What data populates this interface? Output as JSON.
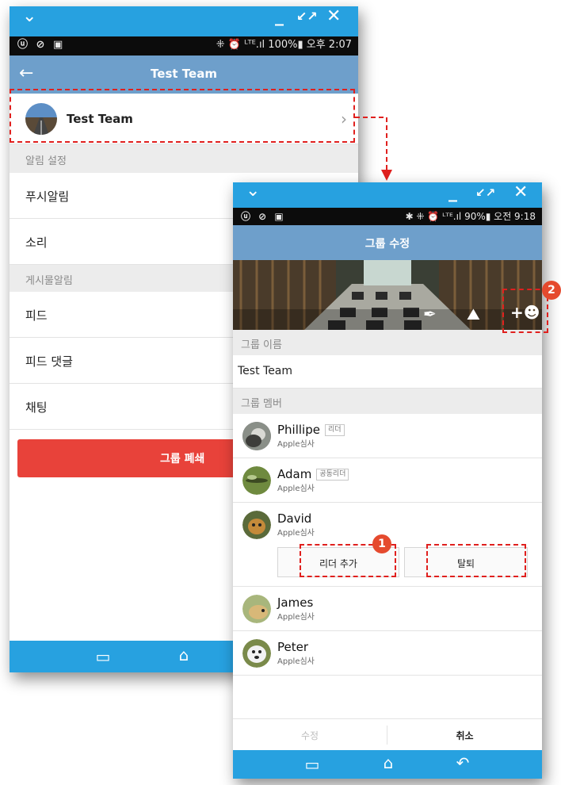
{
  "back_screen": {
    "status": {
      "left": "ⓤ ⊘ ▣",
      "right": "⁜ ⏰ ᴸᵀᴱ.ıl 100%▮ 오후 2:07"
    },
    "appbar_title": "Test Team",
    "team_name": "Test Team",
    "sections": {
      "notify": "알림 설정",
      "post_notify": "게시물알림"
    },
    "rows": {
      "push": "푸시알림",
      "sound": "소리",
      "feed": "피드",
      "feed_comment": "피드 댓글",
      "chat": "채팅"
    },
    "close_group_label": "그룹 폐쇄"
  },
  "front_screen": {
    "status": {
      "left": "ⓤ ⊘ ▣",
      "right": "✱ ⁜ ⏰ ᴸᵀᴱ.ıl 90%▮ 오전 9:18"
    },
    "appbar_title": "그룹 수정",
    "group_name_section": "그룹 이름",
    "group_name_value": "Test Team",
    "group_member_section": "그룹 멤버",
    "members": [
      {
        "name": "Phillipe",
        "tag": "리더",
        "sub": "Apple심사"
      },
      {
        "name": "Adam",
        "tag": "공동리더",
        "sub": "Apple심사"
      },
      {
        "name": "David",
        "tag": "",
        "sub": "Apple심사"
      },
      {
        "name": "James",
        "tag": "",
        "sub": "Apple심사"
      },
      {
        "name": "Peter",
        "tag": "",
        "sub": "Apple심사"
      }
    ],
    "member_actions": {
      "add_leader": "리더 추가",
      "leave": "탈퇴"
    },
    "footer": {
      "edit": "수정",
      "cancel": "취소"
    }
  },
  "annotations": {
    "one": "1",
    "two": "2"
  },
  "colors": {
    "window_bar": "#27a1e0",
    "app_bar": "#6e9fcb",
    "danger": "#e8423a",
    "callout": "#e0201e"
  }
}
